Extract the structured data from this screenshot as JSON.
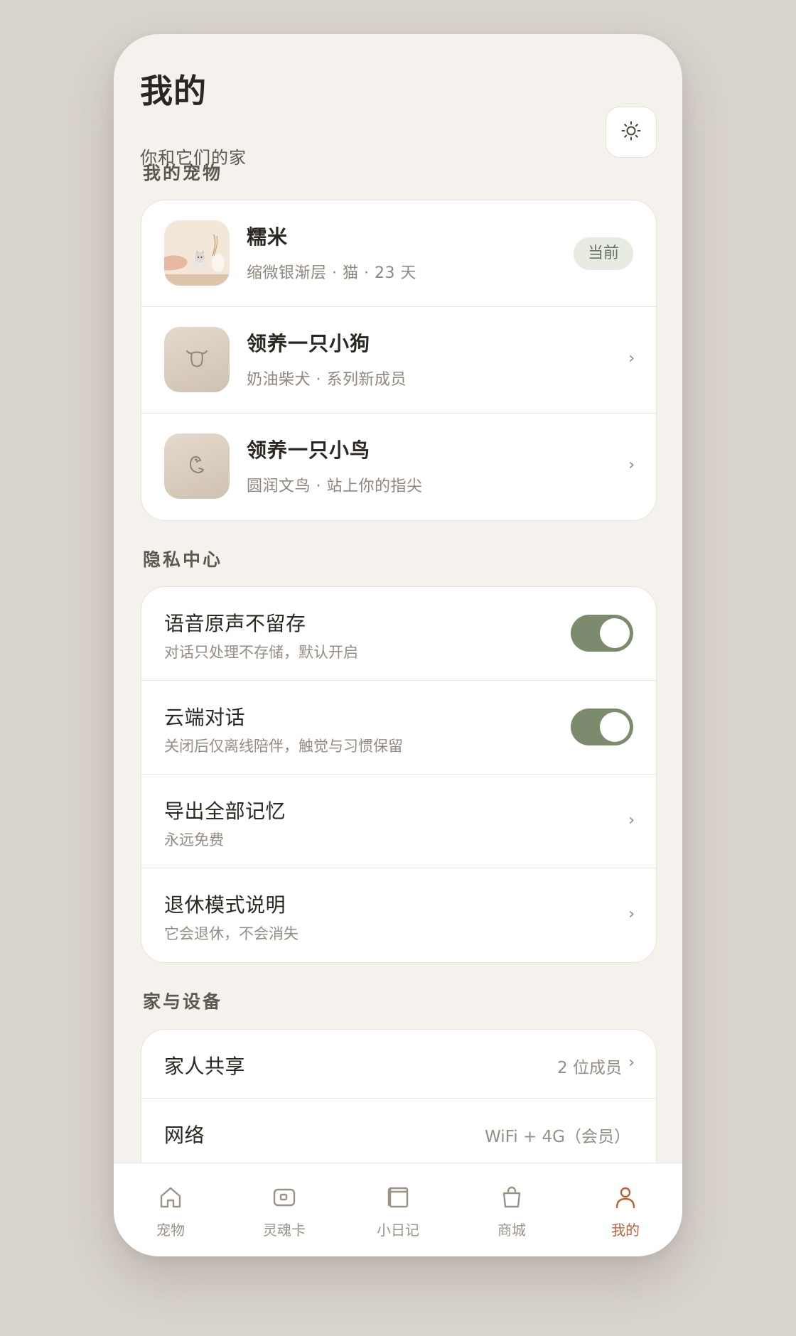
{
  "header": {
    "title": "我的",
    "subtitle": "你和它们的家",
    "theme_button_icon": "sun-icon"
  },
  "sections": {
    "pets": "我的宠物",
    "privacy": "隐私中心",
    "home": "家与设备"
  },
  "pets": [
    {
      "name": "糯米",
      "desc": "缩微银渐层 · 猫 · 23 天",
      "badge": "当前",
      "icon": "cat-photo"
    },
    {
      "name": "领养一只小狗",
      "desc": "奶油柴犬 · 系列新成员",
      "icon": "dog-icon"
    },
    {
      "name": "领养一只小鸟",
      "desc": "圆润文鸟 · 站上你的指尖",
      "icon": "bird-icon"
    }
  ],
  "privacy": [
    {
      "title": "语音原声不留存",
      "desc": "对话只处理不存储，默认开启",
      "toggle": true
    },
    {
      "title": "云端对话",
      "desc": "关闭后仅离线陪伴，触觉与习惯保留",
      "toggle": true
    },
    {
      "title": "导出全部记忆",
      "desc": "永远免费"
    },
    {
      "title": "退休模式说明",
      "desc": "它会退休，不会消失"
    }
  ],
  "home": [
    {
      "title": "家人共享",
      "value": "2 位成员"
    },
    {
      "title": "网络",
      "value": "WiFi + 4G（会员）"
    }
  ],
  "tabs": [
    {
      "label": "宠物",
      "icon": "home-icon"
    },
    {
      "label": "灵魂卡",
      "icon": "card-icon"
    },
    {
      "label": "小日记",
      "icon": "diary-icon"
    },
    {
      "label": "商城",
      "icon": "bag-icon"
    },
    {
      "label": "我的",
      "icon": "person-icon",
      "active": true
    }
  ],
  "colors": {
    "accent": "#b8643b",
    "toggle_on": "#7c8a6d",
    "background": "#f5f2ed"
  }
}
